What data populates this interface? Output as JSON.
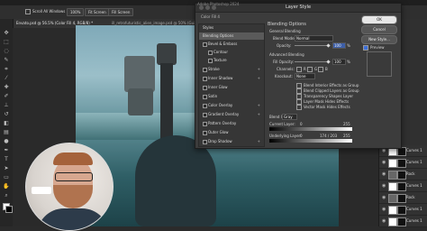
{
  "menubar": {},
  "options_bar": {
    "scroll_all_windows": "Scroll All Windows",
    "zoom_percent": "100%",
    "fit_screen": "Fit Screen",
    "fill_screen": "Fill Screen"
  },
  "document_tab": {
    "title": "Envato.psd @ 56.5% (Color Fill 4, RGB/8) *",
    "second_tab": "ill_retrofuturistic_alien_image.psd @ 50% (Guitar, RGB/8)"
  },
  "dialog": {
    "window_title": "Adobe Photoshop 2024",
    "title": "Layer Style",
    "styles_header": "Styles",
    "styles": [
      {
        "label": "Blending Options",
        "selected": true,
        "fx": ""
      },
      {
        "label": "Bevel & Emboss",
        "selected": false,
        "fx": ""
      },
      {
        "label": "Contour",
        "selected": false,
        "fx": ""
      },
      {
        "label": "Texture",
        "selected": false,
        "fx": ""
      },
      {
        "label": "Stroke",
        "selected": false,
        "fx": "+"
      },
      {
        "label": "Inner Shadow",
        "selected": false,
        "fx": "+"
      },
      {
        "label": "Inner Glow",
        "selected": false,
        "fx": ""
      },
      {
        "label": "Satin",
        "selected": false,
        "fx": ""
      },
      {
        "label": "Color Overlay",
        "selected": false,
        "fx": "+"
      },
      {
        "label": "Gradient Overlay",
        "selected": false,
        "fx": "+"
      },
      {
        "label": "Pattern Overlay",
        "selected": false,
        "fx": ""
      },
      {
        "label": "Outer Glow",
        "selected": false,
        "fx": ""
      },
      {
        "label": "Drop Shadow",
        "selected": false,
        "fx": "+"
      }
    ],
    "layer_name": "Color Fill 4",
    "blending_options_header": "Blending Options",
    "general_blending": "General Blending",
    "blend_mode_label": "Blend Mode:",
    "blend_mode_value": "Normal",
    "opacity_label": "Opacity:",
    "opacity_value": "100",
    "opacity_unit": "%",
    "advanced_blending": "Advanced Blending",
    "fill_opacity_label": "Fill Opacity:",
    "fill_opacity_value": "100",
    "channels_label": "Channels:",
    "channels": [
      "R",
      "G",
      "B"
    ],
    "knockout_label": "Knockout:",
    "knockout_value": "None",
    "checkboxes": [
      "Blend Interior Effects as Group",
      "Blend Clipped Layers as Group",
      "Transparency Shapes Layer",
      "Layer Mask Hides Effects",
      "Vector Mask Hides Effects"
    ],
    "blend_if_label": "Blend If:",
    "blend_if_value": "Gray",
    "current_layer_label": "Current Layer:",
    "current_layer_values": [
      "0",
      "255"
    ],
    "underlying_layer_label": "Underlying Layer:",
    "underlying_layer_values": [
      "0",
      "174 / 203",
      "255"
    ],
    "buttons": {
      "ok": "OK",
      "cancel": "Cancel",
      "new_style": "New Style...",
      "preview": "Preview"
    }
  },
  "layers_panel": {
    "layers": [
      {
        "name": "Curves 1"
      },
      {
        "name": "Curves 1"
      },
      {
        "name": "Rock"
      },
      {
        "name": "Curves 1"
      },
      {
        "name": "Rock"
      },
      {
        "name": "Curves 1"
      },
      {
        "name": "Curves 1"
      }
    ]
  },
  "colors": {
    "dialog_bg": "#3c3c3c",
    "panel_bg": "#303030",
    "canvas_top": "#7fa9b8",
    "canvas_bottom": "#1d4248"
  }
}
